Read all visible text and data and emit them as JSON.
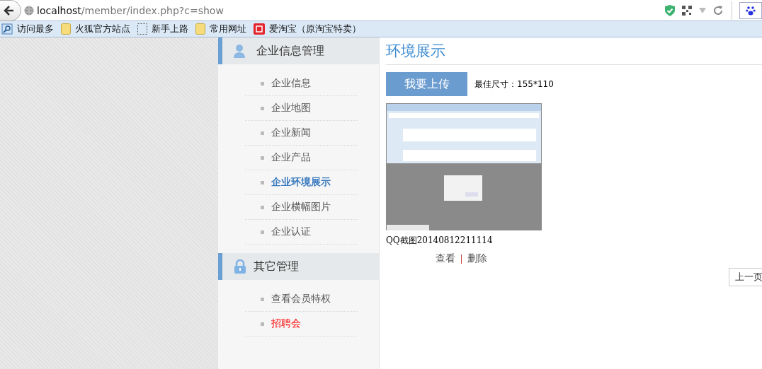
{
  "browser": {
    "url_host": "localhost",
    "url_path": "/member/index.php?c=show",
    "bookmarks": [
      {
        "label": "访问最多",
        "kind": "recent"
      },
      {
        "label": "火狐官方站点",
        "kind": "folder"
      },
      {
        "label": "新手上路",
        "kind": "page"
      },
      {
        "label": "常用网址",
        "kind": "folder"
      },
      {
        "label": "爱淘宝（原淘宝特卖）",
        "kind": "taobao"
      }
    ]
  },
  "sidebar": {
    "sections": [
      {
        "title": "企业信息管理",
        "items": [
          {
            "label": "企业信息",
            "selected": false,
            "color": "#555555"
          },
          {
            "label": "企业地图",
            "selected": false,
            "color": "#555555"
          },
          {
            "label": "企业新闻",
            "selected": false,
            "color": "#555555"
          },
          {
            "label": "企业产品",
            "selected": false,
            "color": "#555555"
          },
          {
            "label": "企业环境展示",
            "selected": true,
            "color": "#3a7bbf"
          },
          {
            "label": "企业横幅图片",
            "selected": false,
            "color": "#555555"
          },
          {
            "label": "企业认证",
            "selected": false,
            "color": "#555555"
          }
        ]
      },
      {
        "title": "其它管理",
        "items": [
          {
            "label": "查看会员特权",
            "selected": false,
            "color": "#555555"
          },
          {
            "label": "招聘会",
            "selected": false,
            "color": "#ff0000"
          }
        ]
      }
    ]
  },
  "main": {
    "title": "环境展示",
    "upload_button": "我要上传",
    "size_hint": "最佳尺寸：155*110",
    "photos": [
      {
        "kind": "picture",
        "caption": "QQ截图20140812211114",
        "actions": [
          "查看",
          "删除"
        ]
      }
    ],
    "pagination": [
      "上一页"
    ]
  }
}
